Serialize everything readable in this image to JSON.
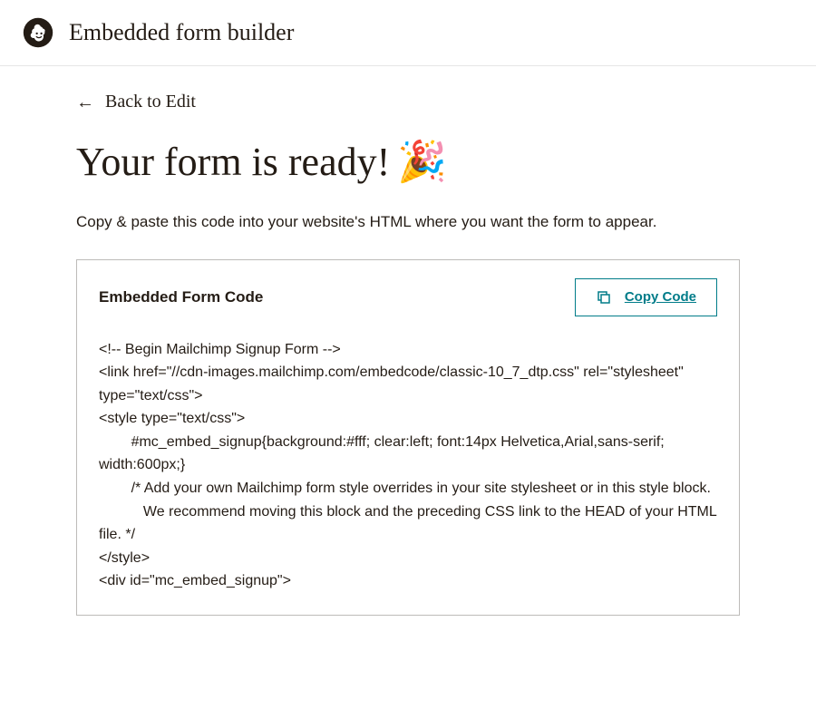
{
  "header": {
    "title": "Embedded form builder"
  },
  "back": {
    "label": "Back to Edit"
  },
  "main": {
    "title": "Your form is ready!",
    "emoji": "🎉",
    "instruction": "Copy & paste this code into your website's HTML where you want the form to appear."
  },
  "codePanel": {
    "title": "Embedded Form Code",
    "copyLabel": "Copy Code",
    "code": "<!-- Begin Mailchimp Signup Form -->\n<link href=\"//cdn-images.mailchimp.com/embedcode/classic-10_7_dtp.css\" rel=\"stylesheet\" type=\"text/css\">\n<style type=\"text/css\">\n        #mc_embed_signup{background:#fff; clear:left; font:14px Helvetica,Arial,sans-serif;  width:600px;}\n        /* Add your own Mailchimp form style overrides in your site stylesheet or in this style block.\n           We recommend moving this block and the preceding CSS link to the HEAD of your HTML file. */\n</style>\n<div id=\"mc_embed_signup\">"
  }
}
